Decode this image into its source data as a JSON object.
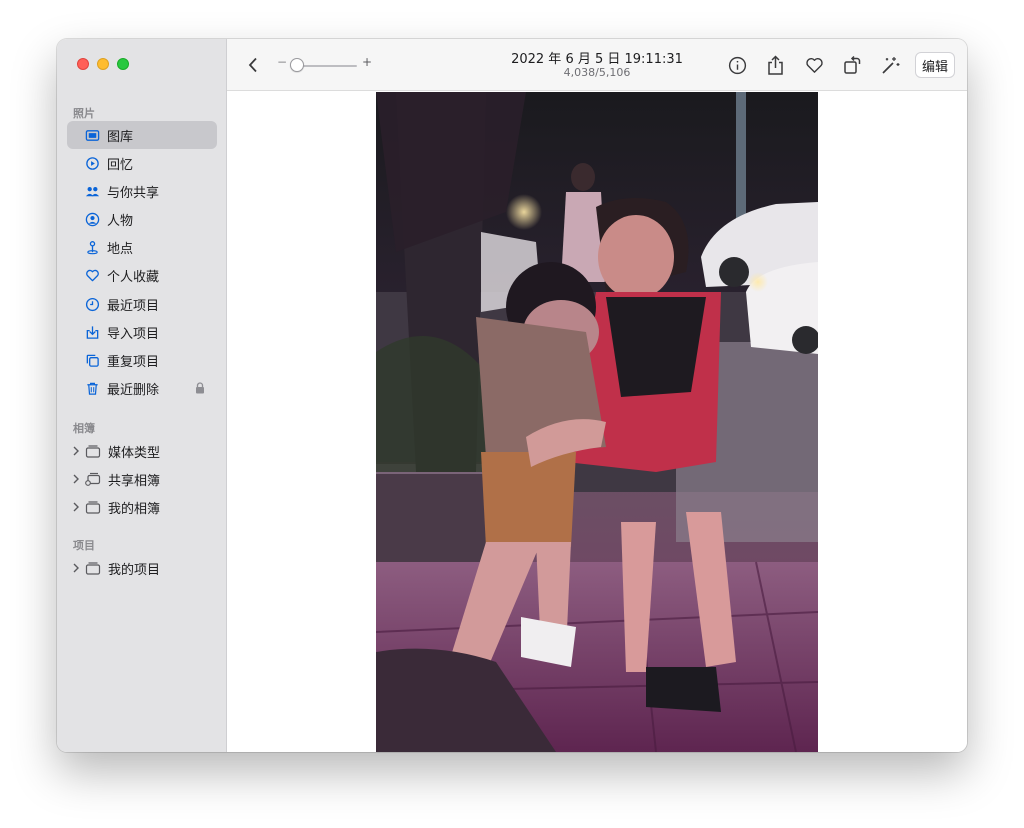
{
  "window": {
    "traffic_lights": [
      "close",
      "minimize",
      "zoom"
    ]
  },
  "sidebar": {
    "sections": {
      "photos": "照片",
      "albums": "相簿",
      "projects": "项目"
    },
    "items": [
      {
        "label": "图库",
        "icon": "photo-library-icon"
      },
      {
        "label": "回忆",
        "icon": "memories-icon"
      },
      {
        "label": "与你共享",
        "icon": "shared-with-you-icon"
      },
      {
        "label": "人物",
        "icon": "people-icon"
      },
      {
        "label": "地点",
        "icon": "places-icon"
      },
      {
        "label": "个人收藏",
        "icon": "heart-icon"
      },
      {
        "label": "最近项目",
        "icon": "clock-icon"
      },
      {
        "label": "导入项目",
        "icon": "import-icon"
      },
      {
        "label": "重复项目",
        "icon": "duplicates-icon"
      },
      {
        "label": "最近删除",
        "icon": "trash-icon"
      }
    ],
    "selected_index": 0,
    "albums": [
      {
        "label": "媒体类型"
      },
      {
        "label": "共享相簿"
      },
      {
        "label": "我的相簿"
      }
    ],
    "projects": [
      {
        "label": "我的项目"
      }
    ]
  },
  "toolbar": {
    "title": "2022 年 6 月 5 日 19:11:31",
    "subtitle": "4,038/5,106",
    "zoom_minus": "−",
    "zoom_plus": "+",
    "edit_label": "编辑",
    "icons": [
      "back-chevron-icon",
      "info-icon",
      "share-icon",
      "heart-icon",
      "rotate-icon",
      "magic-wand-icon"
    ]
  },
  "photo": {
    "accent": "#b0407a",
    "ground": "#6a2a55"
  }
}
